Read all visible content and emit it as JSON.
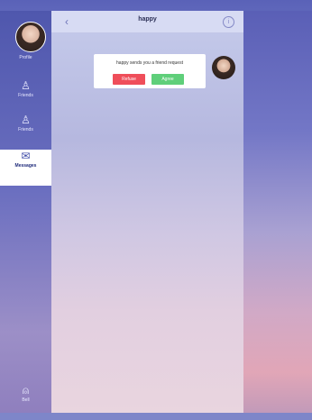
{
  "status_bar": {
    "carrier": "",
    "time": "",
    "battery": ""
  },
  "sidebar": {
    "items": [
      {
        "label": "Profile"
      },
      {
        "label": "Friends"
      },
      {
        "label": "Friends"
      },
      {
        "label": "Messages"
      },
      {
        "label": "Bell"
      }
    ]
  },
  "chat": {
    "title": "happy",
    "timestamp": "",
    "message": "happy sends you a friend request",
    "refuse_label": "Refuse",
    "agree_label": "Agree"
  },
  "colors": {
    "accent": "#5a62b8",
    "refuse": "#ef4e5a",
    "agree": "#5fcf7a"
  }
}
